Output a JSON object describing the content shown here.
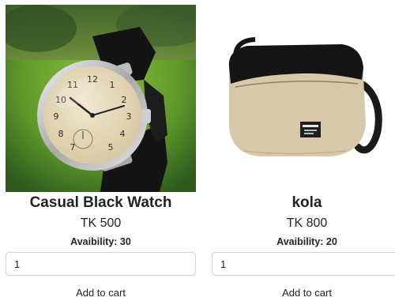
{
  "products": [
    {
      "name": "Casual Black Watch",
      "price": "TK 500",
      "availability": "Avaibility: 30",
      "quantity": "1",
      "add_to_cart_label": "Add to cart",
      "image_icon": "wristwatch-photo"
    },
    {
      "name": "kola",
      "price": "TK 800",
      "availability": "Avaibility: 20",
      "quantity": "1",
      "add_to_cart_label": "Add to cart",
      "image_icon": "crossbody-bag-photo"
    }
  ]
}
